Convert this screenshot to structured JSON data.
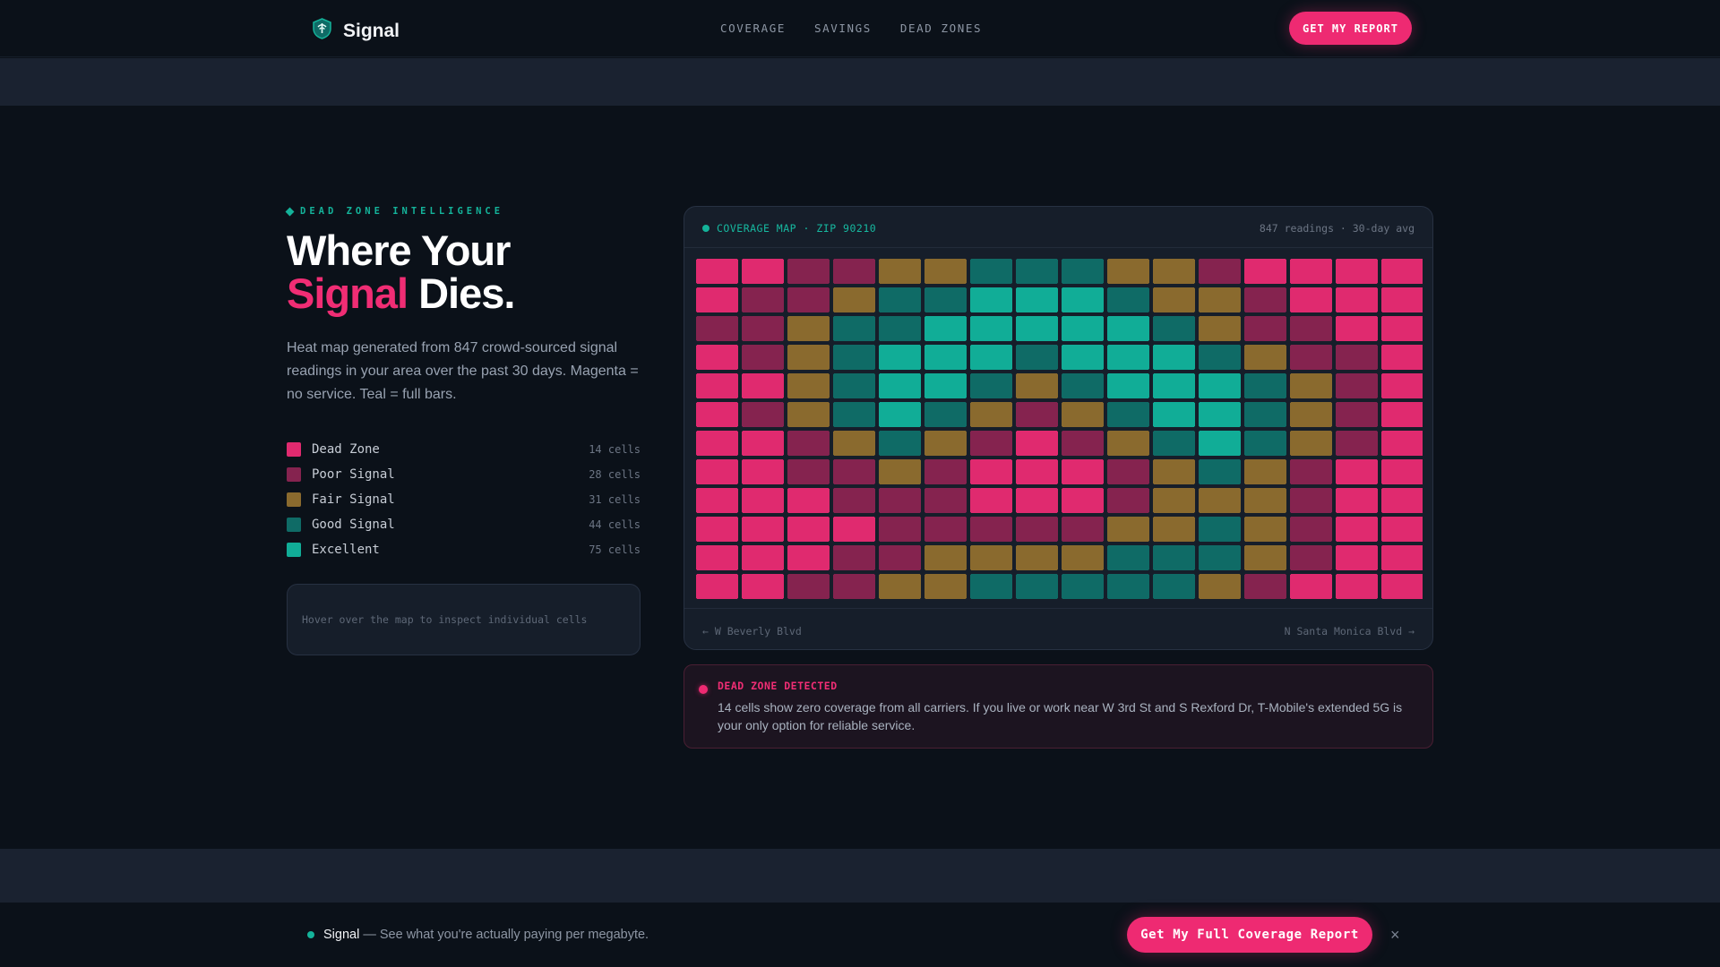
{
  "nav": {
    "brand": "Signal",
    "links": [
      "COVERAGE",
      "SAVINGS",
      "DEAD ZONES"
    ],
    "cta": "GET MY REPORT"
  },
  "hero": {
    "eyebrow": "DEAD ZONE INTELLIGENCE",
    "headline_line1": "Where Your",
    "headline_accent": "Signal",
    "headline_rest": "Dies.",
    "lead": "Heat map generated from 847 crowd-sourced signal readings in your area over the past 30 days. Magenta = no service. Teal = full bars."
  },
  "legend": [
    {
      "label": "Dead Zone",
      "count": "14 cells",
      "color": "#e02a6f"
    },
    {
      "label": "Poor Signal",
      "count": "28 cells",
      "color": "#85234f"
    },
    {
      "label": "Fair Signal",
      "count": "31 cells",
      "color": "#8a6a2e"
    },
    {
      "label": "Good Signal",
      "count": "44 cells",
      "color": "#0f6b66"
    },
    {
      "label": "Excellent",
      "count": "75 cells",
      "color": "#11ad97"
    }
  ],
  "inspect_hint": "Hover over the map to inspect individual cells",
  "map": {
    "title": "COVERAGE MAP · ZIP 90210",
    "meta": "847 readings · 30-day avg",
    "street_left": "← W Beverly Blvd",
    "street_right": "N Santa Monica Blvd →",
    "level_colors": [
      "#e02a6f",
      "#85234f",
      "#8a6a2e",
      "#0f6b66",
      "#11ad97"
    ],
    "rows": [
      [
        0,
        0,
        1,
        1,
        2,
        2,
        3,
        3,
        3,
        2,
        2,
        1,
        0,
        0,
        0,
        0
      ],
      [
        0,
        1,
        1,
        2,
        3,
        3,
        4,
        4,
        4,
        3,
        2,
        2,
        1,
        0,
        0,
        0
      ],
      [
        1,
        1,
        2,
        3,
        3,
        4,
        4,
        4,
        4,
        4,
        3,
        2,
        1,
        1,
        0,
        0
      ],
      [
        0,
        1,
        2,
        3,
        4,
        4,
        4,
        3,
        4,
        4,
        4,
        3,
        2,
        1,
        1,
        0
      ],
      [
        0,
        0,
        2,
        3,
        4,
        4,
        3,
        2,
        3,
        4,
        4,
        4,
        3,
        2,
        1,
        0
      ],
      [
        0,
        1,
        2,
        3,
        4,
        3,
        2,
        1,
        2,
        3,
        4,
        4,
        3,
        2,
        1,
        0
      ],
      [
        0,
        0,
        1,
        2,
        3,
        2,
        1,
        0,
        1,
        2,
        3,
        4,
        3,
        2,
        1,
        0
      ],
      [
        0,
        0,
        1,
        1,
        2,
        1,
        0,
        0,
        0,
        1,
        2,
        3,
        2,
        1,
        0,
        0
      ],
      [
        0,
        0,
        0,
        1,
        1,
        1,
        0,
        0,
        0,
        1,
        2,
        2,
        2,
        1,
        0,
        0
      ],
      [
        0,
        0,
        0,
        0,
        1,
        1,
        1,
        1,
        1,
        2,
        2,
        3,
        2,
        1,
        0,
        0
      ],
      [
        0,
        0,
        0,
        1,
        1,
        2,
        2,
        2,
        2,
        3,
        3,
        3,
        2,
        1,
        0,
        0
      ],
      [
        0,
        0,
        1,
        1,
        2,
        2,
        3,
        3,
        3,
        3,
        3,
        2,
        1,
        0,
        0,
        0
      ]
    ]
  },
  "alert": {
    "title": "DEAD ZONE DETECTED",
    "body": "14 cells show zero coverage from all carriers. If you live or work near W 3rd St and S Rexford Dr, T-Mobile's extended 5G is your only option for reliable service."
  },
  "sticky": {
    "brand": "Signal",
    "tagline": "— See what you're actually paying per megabyte.",
    "cta": "Get My Full Coverage Report",
    "close": "×"
  },
  "colors": {
    "accent": "#ee2a72",
    "teal": "#14b39a",
    "background": "#0b1119"
  }
}
